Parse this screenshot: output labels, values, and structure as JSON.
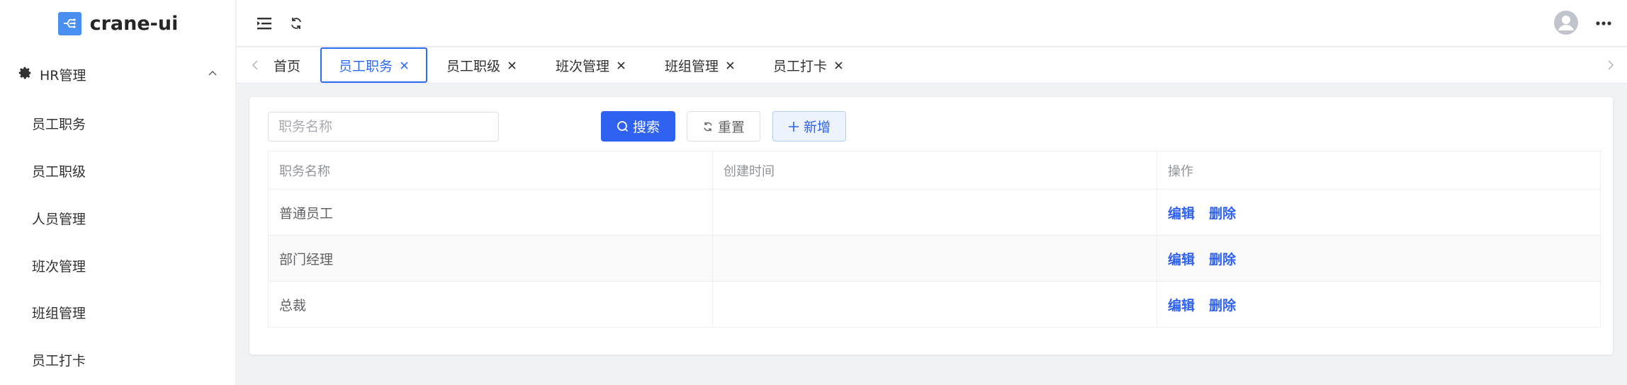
{
  "app": {
    "name": "crane-ui"
  },
  "sidebar": {
    "group": {
      "label": "HR管理"
    },
    "items": [
      {
        "label": "员工职务"
      },
      {
        "label": "员工职级"
      },
      {
        "label": "人员管理"
      },
      {
        "label": "班次管理"
      },
      {
        "label": "班组管理"
      },
      {
        "label": "员工打卡"
      }
    ]
  },
  "tabs": [
    {
      "label": "首页"
    },
    {
      "label": "员工职务"
    },
    {
      "label": "员工职级"
    },
    {
      "label": "班次管理"
    },
    {
      "label": "班组管理"
    },
    {
      "label": "员工打卡"
    }
  ],
  "search": {
    "placeholder": "职务名称",
    "value": "",
    "search_label": "搜索",
    "reset_label": "重置",
    "add_label": "新增"
  },
  "table": {
    "headers": [
      "职务名称",
      "创建时间",
      "操作"
    ],
    "rows": [
      {
        "name": "普通员工",
        "created": ""
      },
      {
        "name": "部门经理",
        "created": ""
      },
      {
        "name": "总裁",
        "created": ""
      }
    ],
    "actions": {
      "edit": "编辑",
      "delete": "删除"
    }
  },
  "colors": {
    "primary": "#2f62f0",
    "active_tab": "#2f6bf2",
    "logo": "#4a8ef0"
  }
}
